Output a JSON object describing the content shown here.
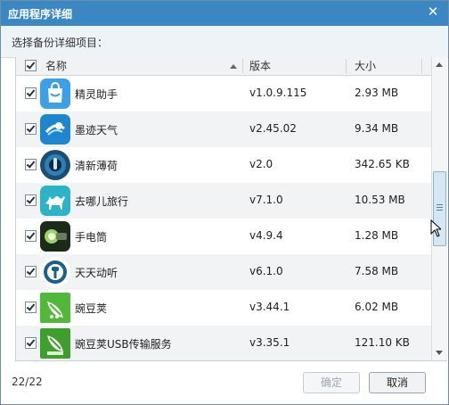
{
  "window": {
    "title": "应用程序详细",
    "close_icon": "close-icon"
  },
  "subtitle": "选择备份详细项目：",
  "table": {
    "columns": {
      "name": "名称",
      "version": "版本",
      "size": "大小"
    },
    "select_all_checked": true,
    "rows": [
      {
        "name": "精灵助手",
        "version": "v1.0.9.115",
        "size": "2.93 MB",
        "icon": "shopping-bag-icon",
        "color": "#3aa0e8",
        "checked": true
      },
      {
        "name": "墨迹天气",
        "version": "v2.45.02",
        "size": "9.34 MB",
        "icon": "weather-swirl-icon",
        "color": "#1e86d0",
        "checked": true
      },
      {
        "name": "清新薄荷",
        "version": "v2.0",
        "size": "342.65 KB",
        "icon": "mint-circle-icon",
        "color": "#1a4f74",
        "checked": true
      },
      {
        "name": "去哪儿旅行",
        "version": "v7.1.0",
        "size": "10.53 MB",
        "icon": "camel-icon",
        "color": "#2bb3c8",
        "checked": true
      },
      {
        "name": "手电筒",
        "version": "v4.9.4",
        "size": "1.28 MB",
        "icon": "flashlight-icon",
        "color": "#2b6b1f",
        "checked": true
      },
      {
        "name": "天天动听",
        "version": "v6.1.0",
        "size": "7.58 MB",
        "icon": "headphone-icon",
        "color": "#1d5f8c",
        "checked": true
      },
      {
        "name": "豌豆荚",
        "version": "v3.44.1",
        "size": "6.02 MB",
        "icon": "peapod-icon",
        "color": "#52b83a",
        "checked": true
      },
      {
        "name": "豌豆荚USB传输服务",
        "version": "v3.35.1",
        "size": "121.10 KB",
        "icon": "peapod-usb-icon",
        "color": "#3f9f2d",
        "checked": true
      }
    ]
  },
  "footer": {
    "count": "22/22",
    "ok_label": "确定",
    "cancel_label": "取消"
  },
  "colors": {
    "titlebar": "#3b87c3",
    "accent": "#3aa0e8"
  }
}
